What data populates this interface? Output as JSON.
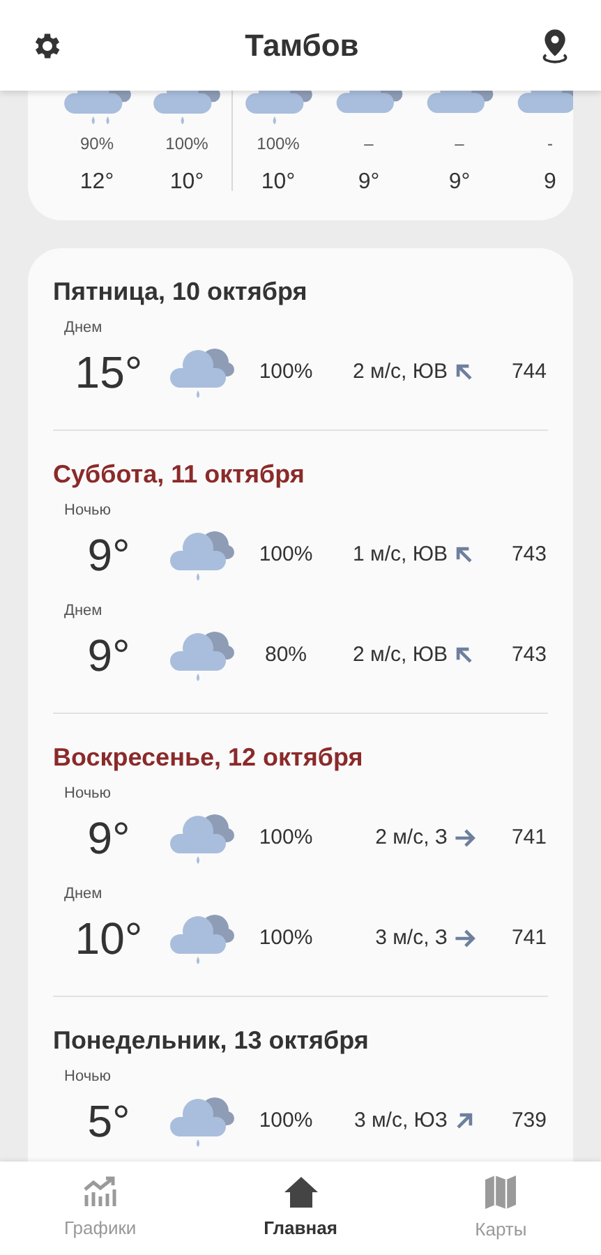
{
  "header": {
    "title": "Тамбов"
  },
  "hourly": [
    {
      "kind": "heavy",
      "precip": "90%",
      "temp": "12°",
      "divider_after": false
    },
    {
      "kind": "light",
      "precip": "100%",
      "temp": "10°",
      "divider_after": true
    },
    {
      "kind": "light",
      "precip": "100%",
      "temp": "10°",
      "divider_after": false
    },
    {
      "kind": "dry",
      "precip": "–",
      "temp": "9°",
      "divider_after": false
    },
    {
      "kind": "dry",
      "precip": "–",
      "temp": "9°",
      "divider_after": false
    },
    {
      "kind": "dry",
      "precip": "-",
      "temp": "9",
      "divider_after": false
    }
  ],
  "days": [
    {
      "title": "Пятница, 10 октября",
      "weekend": false,
      "rows": [
        {
          "period": "Днем",
          "temp": "15°",
          "precip": "100%",
          "wind": "2 м/с, ЮВ",
          "kind": "northwest",
          "pressure": "744"
        }
      ]
    },
    {
      "title": "Суббота, 11 октября",
      "weekend": true,
      "rows": [
        {
          "period": "Ночью",
          "temp": "9°",
          "precip": "100%",
          "wind": "1 м/с, ЮВ",
          "kind": "northwest",
          "pressure": "743"
        },
        {
          "period": "Днем",
          "temp": "9°",
          "precip": "80%",
          "wind": "2 м/с, ЮВ",
          "kind": "northwest",
          "pressure": "743"
        }
      ]
    },
    {
      "title": "Воскресенье, 12 октября",
      "weekend": true,
      "rows": [
        {
          "period": "Ночью",
          "temp": "9°",
          "precip": "100%",
          "wind": "2 м/с, З",
          "kind": "east",
          "pressure": "741"
        },
        {
          "period": "Днем",
          "temp": "10°",
          "precip": "100%",
          "wind": "3 м/с, З",
          "kind": "east",
          "pressure": "741"
        }
      ]
    },
    {
      "title": "Понедельник, 13 октября",
      "weekend": false,
      "rows": [
        {
          "period": "Ночью",
          "temp": "5°",
          "precip": "100%",
          "wind": "3 м/с, ЮЗ",
          "kind": "northeast",
          "pressure": "739"
        }
      ]
    }
  ],
  "nav": [
    {
      "label": "Графики",
      "kind": "chart",
      "selected": false
    },
    {
      "label": "Главная",
      "kind": "home",
      "selected": true
    },
    {
      "label": "Карты",
      "kind": "map",
      "selected": false
    }
  ]
}
